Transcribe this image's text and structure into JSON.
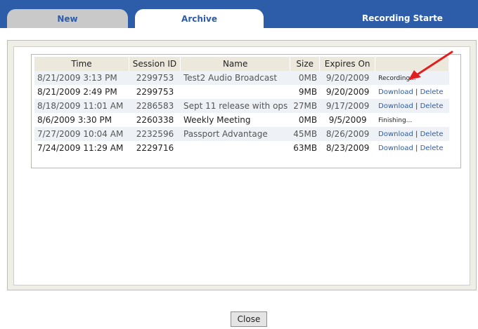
{
  "tabs": [
    {
      "label": "New"
    },
    {
      "label": "Archive"
    }
  ],
  "status_banner": "Recording Starte",
  "table": {
    "headers": [
      "Time",
      "Session ID",
      "Name",
      "Size",
      "Expires On",
      ""
    ],
    "rows": [
      {
        "time": "8/21/2009 3:13 PM",
        "session_id": "2299753",
        "name": "Test2 Audio Broadcast",
        "size": "0MB",
        "expires": "9/20/2009",
        "status": "Recording..."
      },
      {
        "time": "8/21/2009 2:49 PM",
        "session_id": "2299753",
        "name": "",
        "size": "9MB",
        "expires": "9/20/2009",
        "download": "Download",
        "delete": "Delete"
      },
      {
        "time": "8/18/2009 11:01 AM",
        "session_id": "2286583",
        "name": "Sept 11 release with ops",
        "size": "27MB",
        "expires": "9/17/2009",
        "download": "Download",
        "delete": "Delete"
      },
      {
        "time": "8/6/2009 3:30 PM",
        "session_id": "2260338",
        "name": "Weekly Meeting",
        "size": "0MB",
        "expires": "9/5/2009",
        "status": "Finishing..."
      },
      {
        "time": "7/27/2009 10:04 AM",
        "session_id": "2232596",
        "name": "Passport Advantage",
        "size": "45MB",
        "expires": "8/26/2009",
        "download": "Download",
        "delete": "Delete"
      },
      {
        "time": "7/24/2009 11:29 AM",
        "session_id": "2229716",
        "name": "",
        "size": "63MB",
        "expires": "8/23/2009",
        "download": "Download",
        "delete": "Delete"
      }
    ]
  },
  "separator": "|",
  "close_label": "Close",
  "colors": {
    "header_bar": "#2d5ca9",
    "arrow": "#e02020",
    "link": "#2d5ca9"
  }
}
